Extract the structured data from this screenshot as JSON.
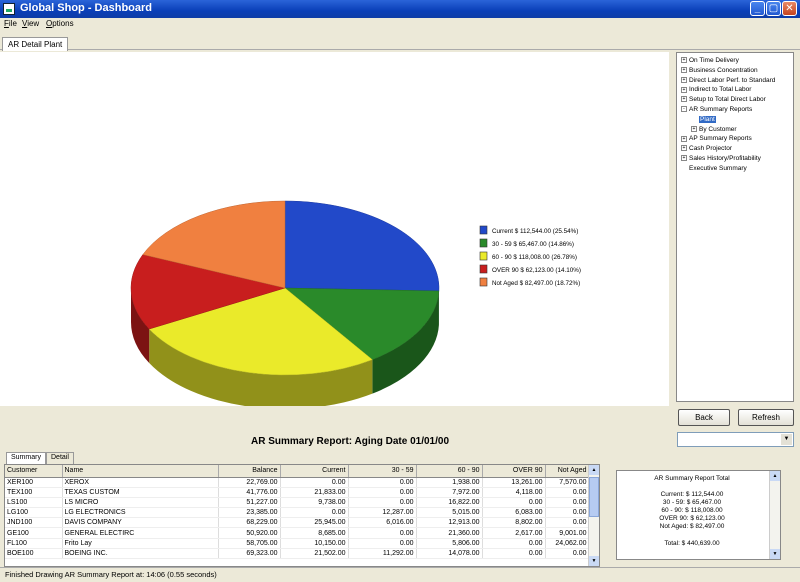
{
  "window": {
    "title": "Global Shop - Dashboard",
    "minimize": "_",
    "maximize": "▢",
    "close": "✕"
  },
  "menu": [
    "File",
    "View",
    "Options"
  ],
  "tabs": {
    "main": "AR Detail Plant"
  },
  "tree": [
    {
      "label": "On Time Delivery",
      "expander": "+",
      "level": 0
    },
    {
      "label": "Business Concentration",
      "expander": "+",
      "level": 0
    },
    {
      "label": "Direct Labor Perf. to Standard",
      "expander": "+",
      "level": 0
    },
    {
      "label": "Indirect to Total Labor",
      "expander": "+",
      "level": 0
    },
    {
      "label": "Setup to Total Direct Labor",
      "expander": "+",
      "level": 0
    },
    {
      "label": "AR Summary Reports",
      "expander": "-",
      "level": 0
    },
    {
      "label": "Plant",
      "expander": "",
      "level": 1,
      "selected": true
    },
    {
      "label": "By Customer",
      "expander": "+",
      "level": 1
    },
    {
      "label": "AP Summary Reports",
      "expander": "+",
      "level": 0
    },
    {
      "label": "Cash Projector",
      "expander": "+",
      "level": 0
    },
    {
      "label": "Sales History/Profitability",
      "expander": "+",
      "level": 0
    },
    {
      "label": "Executive Summary",
      "expander": "",
      "level": 0
    }
  ],
  "buttons": {
    "back": "Back",
    "refresh": "Refresh"
  },
  "report": {
    "title": "AR Summary Report: Aging Date 01/01/00"
  },
  "subtabs": {
    "summary": "Summary",
    "detail": "Detail"
  },
  "grid": {
    "columns": [
      "Customer",
      "Name",
      "Balance",
      "Current",
      "30 - 59",
      "60 - 90",
      "OVER 90",
      "Not Aged"
    ],
    "rows": [
      [
        "XER100",
        "XEROX",
        "22,769.00",
        "0.00",
        "0.00",
        "1,938.00",
        "13,261.00",
        "7,570.00"
      ],
      [
        "TEX100",
        "TEXAS CUSTOM",
        "41,776.00",
        "21,833.00",
        "0.00",
        "7,972.00",
        "4,118.00",
        "0.00"
      ],
      [
        "LS100",
        "LS MICRO",
        "51,227.00",
        "9,738.00",
        "0.00",
        "16,822.00",
        "0.00",
        "0.00"
      ],
      [
        "LG100",
        "LG ELECTRONICS",
        "23,385.00",
        "0.00",
        "12,287.00",
        "5,015.00",
        "6,083.00",
        "0.00"
      ],
      [
        "JND100",
        "DAVIS COMPANY",
        "68,229.00",
        "25,945.00",
        "6,016.00",
        "12,913.00",
        "8,802.00",
        "0.00"
      ],
      [
        "GE100",
        "GENERAL ELECTIRC",
        "50,920.00",
        "8,685.00",
        "0.00",
        "21,360.00",
        "2,617.00",
        "9,001.00"
      ],
      [
        "FL100",
        "Frito Lay",
        "58,705.00",
        "10,150.00",
        "0.00",
        "5,806.00",
        "0.00",
        "24,062.00"
      ],
      [
        "BOE100",
        "BOEING INC.",
        "69,323.00",
        "21,502.00",
        "11,292.00",
        "14,078.00",
        "0.00",
        "0.00"
      ]
    ]
  },
  "totals": {
    "title": "AR Summary Report Total",
    "lines": [
      "Current:  $ 112,544.00",
      "30 - 59:  $ 65,467.00",
      "60 - 90:  $ 118,008.00",
      "OVER 90:  $ 62,123.00",
      "Not Aged:  $ 82,497.00"
    ],
    "total": "Total: $ 440,639.00"
  },
  "status": "Finished Drawing AR Summary Report at: 14:06 (0.55 seconds)",
  "chart_data": {
    "type": "pie",
    "title": "",
    "legend_position": "right",
    "categories": [
      "Current",
      "30 - 59",
      "60 - 90",
      "OVER 90",
      "Not Aged"
    ],
    "values": [
      112544.0,
      65467.0,
      118008.0,
      62123.0,
      82497.0
    ],
    "percents": [
      25.54,
      14.86,
      26.78,
      14.1,
      18.72
    ],
    "legend_labels": [
      "Current  $ 112,544.00 (25.54%)",
      "30 - 59  $ 65,467.00 (14.86%)",
      "60 - 90  $ 118,008.00 (26.78%)",
      "OVER 90  $ 62,123.00 (14.10%)",
      "Not Aged  $ 82,497.00 (18.72%)"
    ],
    "colors": [
      "#2249c9",
      "#2a8a2a",
      "#eaea2a",
      "#c81e1e",
      "#f08040"
    ]
  }
}
